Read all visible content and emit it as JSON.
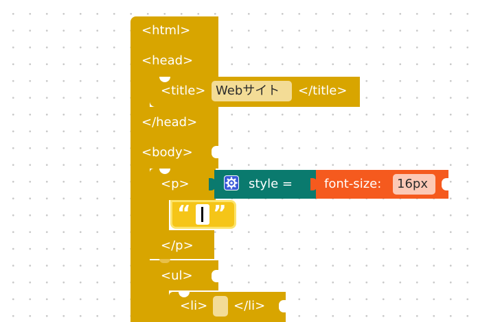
{
  "workspace": {
    "html_open": "<html>",
    "head_open": "<head>",
    "title_open": "<title>",
    "title_value": "Webサイト",
    "title_close": "</title>",
    "head_close": "</head>",
    "body_open": "<body>",
    "p_open": "<p>",
    "style_label": "style =",
    "style_icon": "gear-icon",
    "font_size_label": "font-size:",
    "font_size_value": "16px",
    "text_quote_open": "“",
    "text_quote_close": "”",
    "text_value": "",
    "p_close": "</p>",
    "ul_open": "<ul>",
    "li_open": "<li>",
    "li_value": "",
    "li_close": "</li>"
  },
  "colors": {
    "html_block": "#d8a500",
    "style_block": "#0a7a6e",
    "css_block": "#f55a1e",
    "text_block": "#f5c518",
    "field_bg": "#f3dc96"
  }
}
